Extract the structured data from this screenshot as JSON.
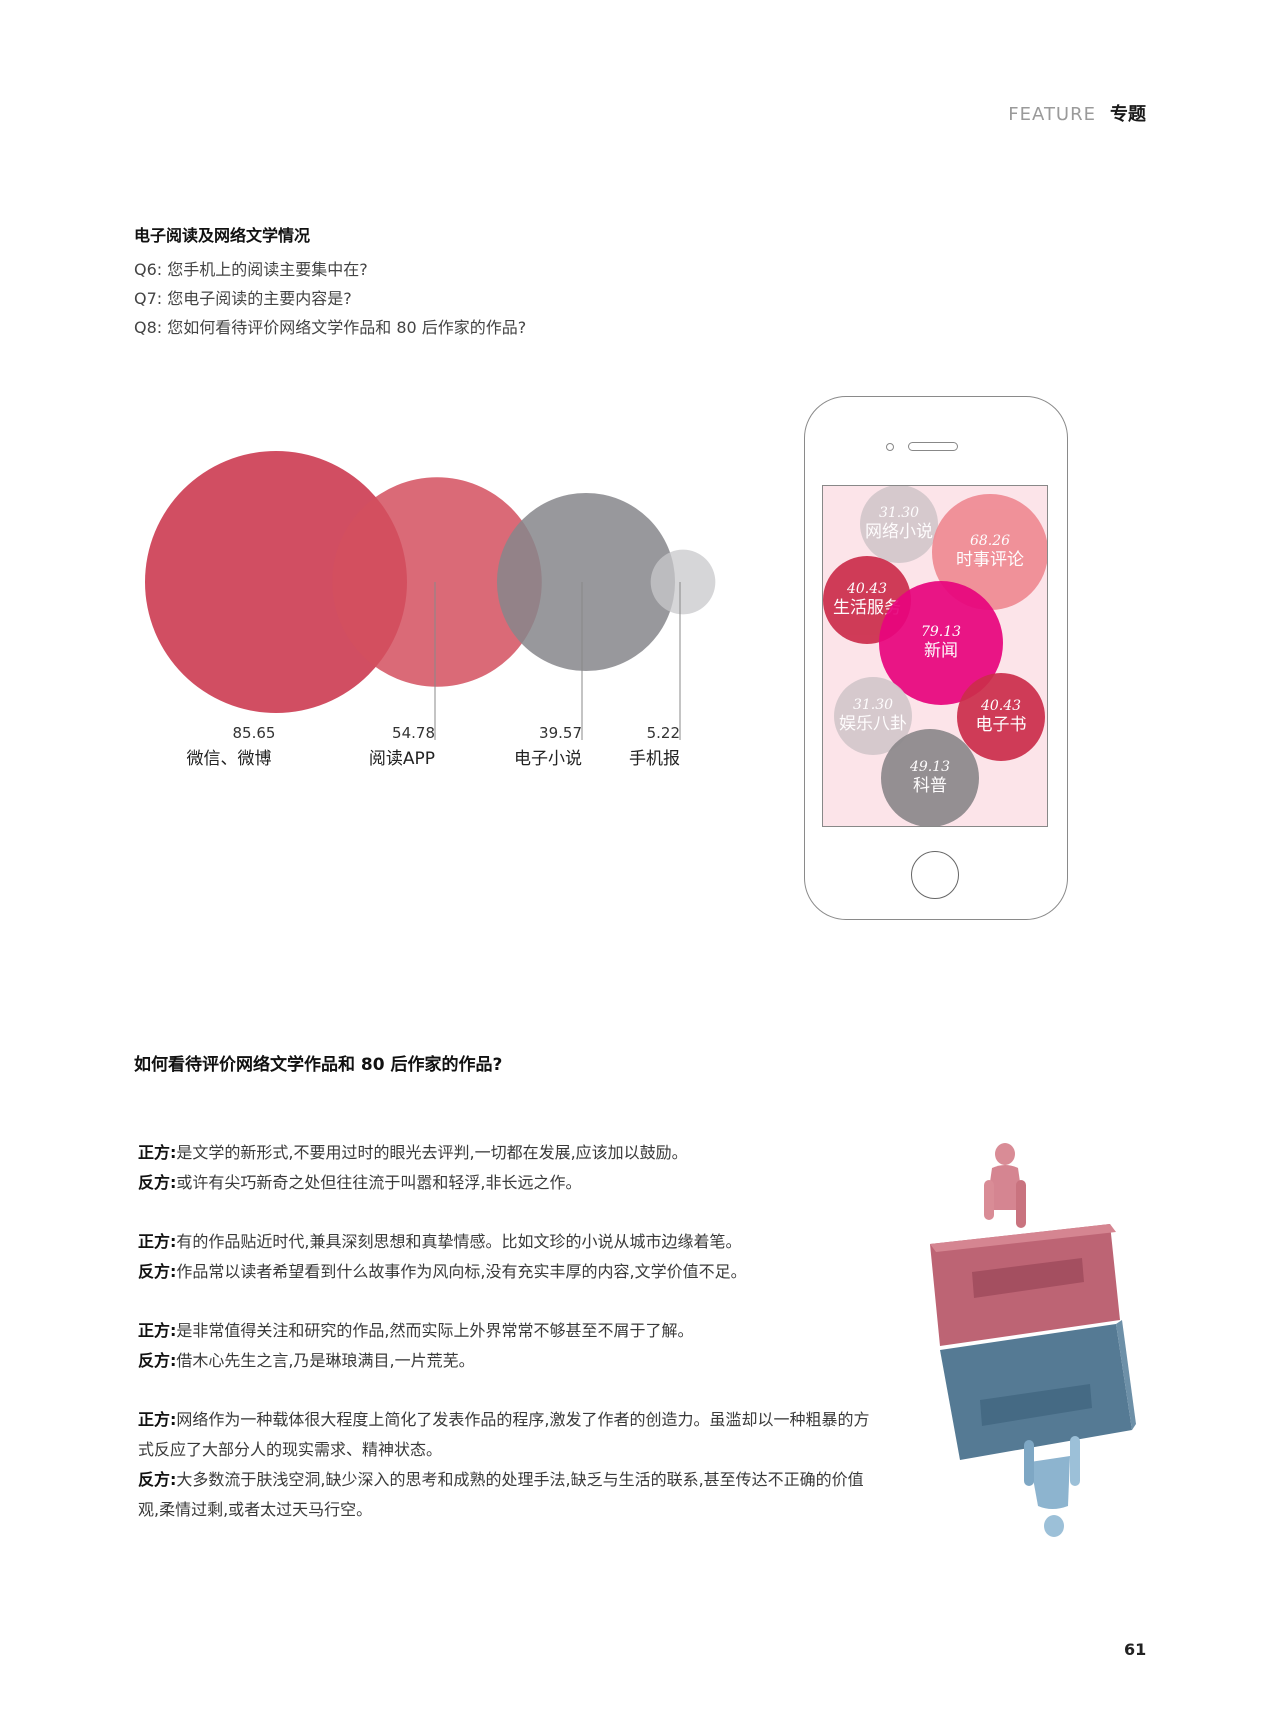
{
  "header": {
    "feature": "FEATURE",
    "section": "专题"
  },
  "intro": {
    "title": "电子阅读及网络文学情况",
    "questions": [
      "Q6: 您手机上的阅读主要集中在?",
      "Q7: 您电子阅读的主要内容是?",
      "Q8: 您如何看待评价网络文学作品和 80 后作家的作品?"
    ]
  },
  "chart_data": [
    {
      "type": "bubble",
      "categories": [
        "微信、微博",
        "阅读APP",
        "电子小说",
        "手机报"
      ],
      "values": [
        85.65,
        54.78,
        39.57,
        5.22
      ],
      "colors": [
        "#c92f46",
        "#d4505f",
        "#86868b",
        "#c8c8cb"
      ]
    },
    {
      "type": "bubble",
      "categories": [
        "网络小说",
        "时事评论",
        "生活服务",
        "新闻",
        "娱乐八卦",
        "电子书",
        "科普"
      ],
      "values": [
        31.3,
        68.26,
        40.43,
        79.13,
        31.3,
        40.43,
        49.13
      ],
      "value_labels": [
        "31.30",
        "68.26",
        "40.43",
        "79.13",
        "31.30",
        "40.43",
        "49.13"
      ],
      "colors": [
        "#d3c7cb",
        "#ef8a93",
        "#cc2d4b",
        "#e8047d",
        "#d3c7cb",
        "#cc2d4b",
        "#8c888b"
      ]
    }
  ],
  "section2": {
    "title": "如何看待评价网络文学作品和 80 后作家的作品?"
  },
  "debate": {
    "pro_label": "正方:",
    "con_label": "反方:",
    "pairs": [
      {
        "pro": "是文学的新形式,不要用过时的眼光去评判,一切都在发展,应该加以鼓励。",
        "con": "或许有尖巧新奇之处但往往流于叫嚣和轻浮,非长远之作。"
      },
      {
        "pro": "有的作品贴近时代,兼具深刻思想和真挚情感。比如文珍的小说从城市边缘着笔。",
        "con": "作品常以读者希望看到什么故事作为风向标,没有充实丰厚的内容,文学价值不足。"
      },
      {
        "pro": "是非常值得关注和研究的作品,然而实际上外界常常不够甚至不屑于了解。",
        "con": "借木心先生之言,乃是琳琅满目,一片荒芜。"
      },
      {
        "pro": "网络作为一种载体很大程度上简化了发表作品的程序,激发了作者的创造力。虽滥却以一种粗暴的方式反应了大部分人的现实需求、精神状态。",
        "con": "大多数流于肤浅空洞,缺少深入的思考和成熟的处理手法,缺乏与生活的联系,甚至传达不正确的价值观,柔情过剩,或者太过天马行空。"
      }
    ]
  },
  "page_number": "61"
}
